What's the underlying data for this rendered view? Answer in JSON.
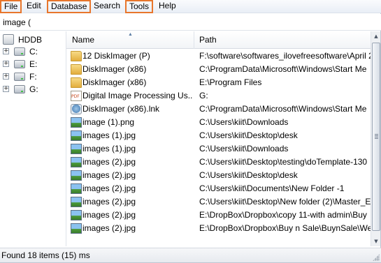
{
  "menu": {
    "items": [
      {
        "label": "File",
        "highlighted": true
      },
      {
        "label": "Edit",
        "highlighted": false
      },
      {
        "label": "Database",
        "highlighted": true
      },
      {
        "label": "Search",
        "highlighted": false
      },
      {
        "label": "Tools",
        "highlighted": true
      },
      {
        "label": "Help",
        "highlighted": false
      }
    ],
    "highlight_color": "#e8762c"
  },
  "search": {
    "value": "image (",
    "placeholder": ""
  },
  "tree": {
    "root": {
      "label": "HDDB",
      "icon": "hard-disk-icon"
    },
    "drives": [
      {
        "label": "C:",
        "icon": "system-drive-icon",
        "expander": "+"
      },
      {
        "label": "E:",
        "icon": "drive-icon",
        "expander": "+"
      },
      {
        "label": "F:",
        "icon": "drive-icon",
        "expander": "+"
      },
      {
        "label": "G:",
        "icon": "drive-icon",
        "expander": "+"
      }
    ]
  },
  "list": {
    "columns": {
      "name": "Name",
      "path": "Path"
    },
    "sort_indicator": "▲",
    "rows": [
      {
        "icon": "folder-icon",
        "type": "folder",
        "name": "12 DiskImager (P)",
        "path": "F:\\software\\softwares_ilovefreesoftware\\April 2"
      },
      {
        "icon": "folder-icon",
        "type": "folder",
        "name": "DiskImager (x86)",
        "path": "C:\\ProgramData\\Microsoft\\Windows\\Start Me"
      },
      {
        "icon": "folder-icon",
        "type": "folder",
        "name": "DiskImager (x86)",
        "path": "E:\\Program Files"
      },
      {
        "icon": "pdf-icon",
        "type": "pdf",
        "name": "Digital Image Processing Us...",
        "path": "G:"
      },
      {
        "icon": "shortcut-icon",
        "type": "link",
        "name": "DiskImager (x86).lnk",
        "path": "C:\\ProgramData\\Microsoft\\Windows\\Start Me"
      },
      {
        "icon": "image-file-icon",
        "type": "image",
        "name": "image (1).png",
        "path": "C:\\Users\\kiit\\Downloads"
      },
      {
        "icon": "image-file-icon",
        "type": "image",
        "name": "images (1).jpg",
        "path": "C:\\Users\\kiit\\Desktop\\desk"
      },
      {
        "icon": "image-file-icon",
        "type": "image",
        "name": "images (1).jpg",
        "path": "C:\\Users\\kiit\\Downloads"
      },
      {
        "icon": "image-file-icon",
        "type": "image",
        "name": "images (2).jpg",
        "path": "C:\\Users\\kiit\\Desktop\\testing\\doTemplate-130"
      },
      {
        "icon": "image-file-icon",
        "type": "image",
        "name": "images (2).jpg",
        "path": "C:\\Users\\kiit\\Desktop\\desk"
      },
      {
        "icon": "image-file-icon",
        "type": "image",
        "name": "images (2).jpg",
        "path": "C:\\Users\\kiit\\Documents\\New Folder -1"
      },
      {
        "icon": "image-file-icon",
        "type": "image",
        "name": "images (2).jpg",
        "path": "C:\\Users\\kiit\\Desktop\\New folder (2)\\Master_E"
      },
      {
        "icon": "image-file-icon",
        "type": "image",
        "name": "images (2).jpg",
        "path": "E:\\DropBox\\Dropbox\\copy 11-with admin\\Buy"
      },
      {
        "icon": "image-file-icon",
        "type": "image",
        "name": "images (2).jpg",
        "path": "E:\\DropBox\\Dropbox\\Buy n Sale\\BuynSale\\We"
      }
    ]
  },
  "scrollbar": {
    "up": "▲",
    "down": "▼"
  },
  "status": {
    "text": "Found 18 items (15) ms"
  }
}
